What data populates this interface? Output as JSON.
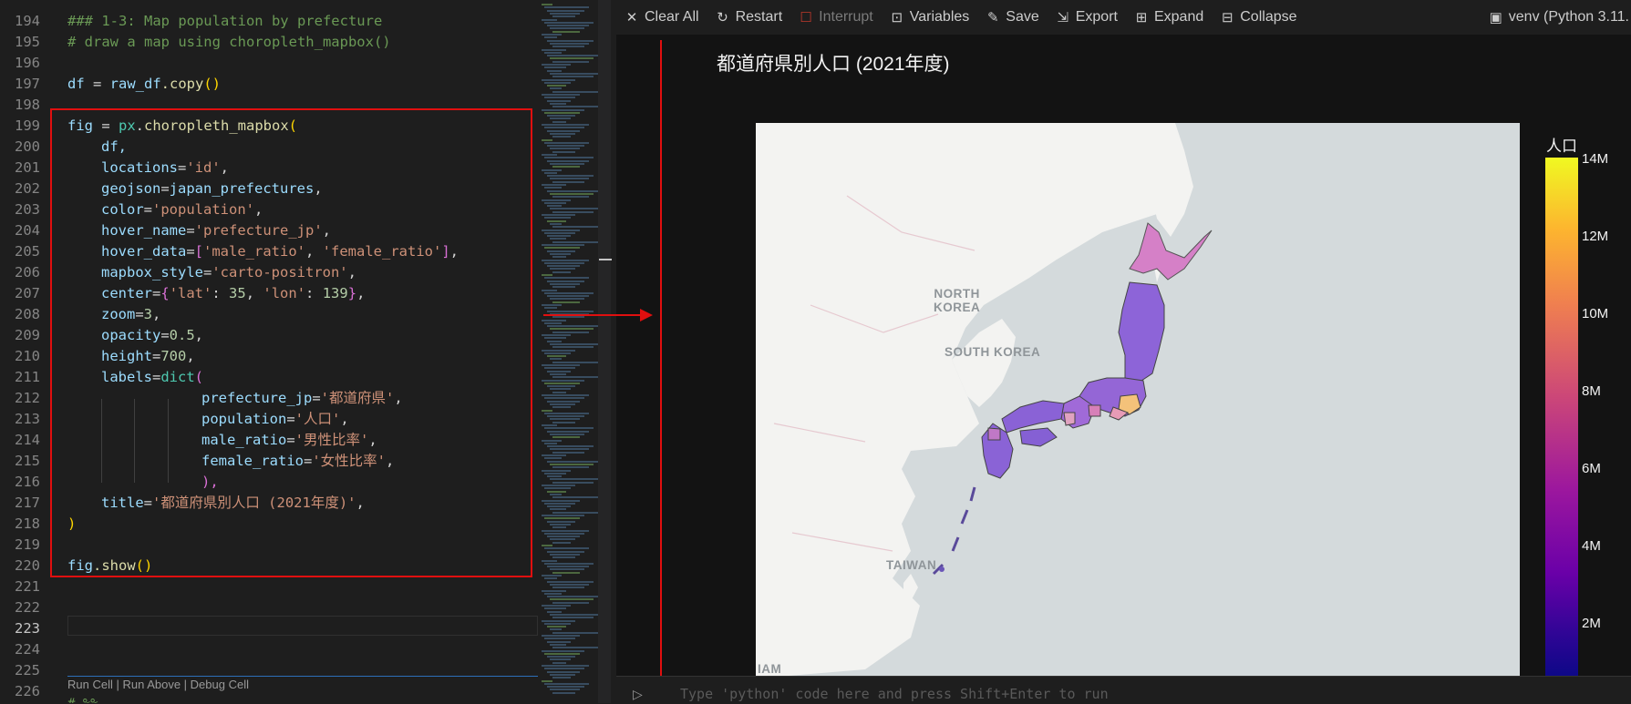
{
  "editor": {
    "line_numbers": [
      "194",
      "195",
      "196",
      "197",
      "198",
      "199",
      "200",
      "201",
      "202",
      "203",
      "204",
      "205",
      "206",
      "207",
      "208",
      "209",
      "210",
      "211",
      "212",
      "213",
      "214",
      "215",
      "216",
      "217",
      "218",
      "219",
      "220",
      "221",
      "222",
      "223",
      "224",
      "225",
      "226"
    ],
    "active_line": "223",
    "code": {
      "l194": "### 1-3: Map population by prefecture",
      "l195": "# draw a map using choropleth_mapbox()",
      "l197_var": "df",
      "l197_eq": " = ",
      "l197_src": "raw_df",
      "l197_call": ".copy",
      "l197_paren": "()",
      "l199_var": "fig",
      "l199_eq": " = ",
      "l199_mod": "px",
      "l199_dot": ".",
      "l199_fn": "choropleth_mapbox",
      "l199_paren": "(",
      "l200": "df,",
      "l201_key": "locations",
      "l201_val": "'id'",
      "l202_key": "geojson",
      "l202_val": "japan_prefectures",
      "l203_key": "color",
      "l203_val": "'population'",
      "l204_key": "hover_name",
      "l204_val": "'prefecture_jp'",
      "l205_key": "hover_data",
      "l205_open": "[",
      "l205_v1": "'male_ratio'",
      "l205_comma": ", ",
      "l205_v2": "'female_ratio'",
      "l205_close": "]",
      "l206_key": "mapbox_style",
      "l206_val": "'carto-positron'",
      "l207_key": "center",
      "l207_open": "{",
      "l207_k1": "'lat'",
      "l207_colon1": ": ",
      "l207_v1": "35",
      "l207_comma": ", ",
      "l207_k2": "'lon'",
      "l207_colon2": ": ",
      "l207_v2": "139",
      "l207_close": "}",
      "l208_key": "zoom",
      "l208_val": "3",
      "l209_key": "opacity",
      "l209_val": "0.5",
      "l210_key": "height",
      "l210_val": "700",
      "l211_key": "labels",
      "l211_fn": "dict",
      "l211_open": "(",
      "l212_key": "prefecture_jp",
      "l212_val": "'都道府県'",
      "l213_key": "population",
      "l213_val": "'人口'",
      "l214_key": "male_ratio",
      "l214_val": "'男性比率'",
      "l215_key": "female_ratio",
      "l215_val": "'女性比率'",
      "l216": "),",
      "l217_key": "title",
      "l217_val": "'都道府県別人口 (2021年度)'",
      "l218": ")",
      "l220_var": "fig",
      "l220_call": ".show",
      "l220_paren": "()",
      "l226": "# %%"
    },
    "codelens": "Run Cell | Run Above | Debug Cell"
  },
  "toolbar": {
    "items": [
      {
        "label": "Clear All",
        "icon": "close-icon"
      },
      {
        "label": "Restart",
        "icon": "restart-icon"
      },
      {
        "label": "Interrupt",
        "icon": "stop-icon"
      },
      {
        "label": "Variables",
        "icon": "variables-icon"
      },
      {
        "label": "Save",
        "icon": "save-icon"
      },
      {
        "label": "Export",
        "icon": "export-icon"
      },
      {
        "label": "Expand",
        "icon": "expand-icon"
      },
      {
        "label": "Collapse",
        "icon": "collapse-icon"
      }
    ],
    "kernel": "venv (Python 3.11."
  },
  "figure": {
    "title": "都道府県別人口 (2021年度)",
    "map_labels": {
      "north_korea_1": "NORTH",
      "north_korea_2": "KOREA",
      "south_korea": "SOUTH KOREA",
      "taiwan": "TAIWAN",
      "vietnam_partial": "IAM"
    },
    "colorbar": {
      "title": "人口",
      "ticks": [
        "14M",
        "12M",
        "10M",
        "8M",
        "6M",
        "4M",
        "2M"
      ],
      "colors": [
        "#f0f921",
        "#fdb42f",
        "#f0804f",
        "#cc4778",
        "#9c179e",
        "#6a00a8",
        "#0d0887"
      ]
    }
  },
  "input": {
    "placeholder": "Type 'python' code here and press Shift+Enter to run"
  }
}
